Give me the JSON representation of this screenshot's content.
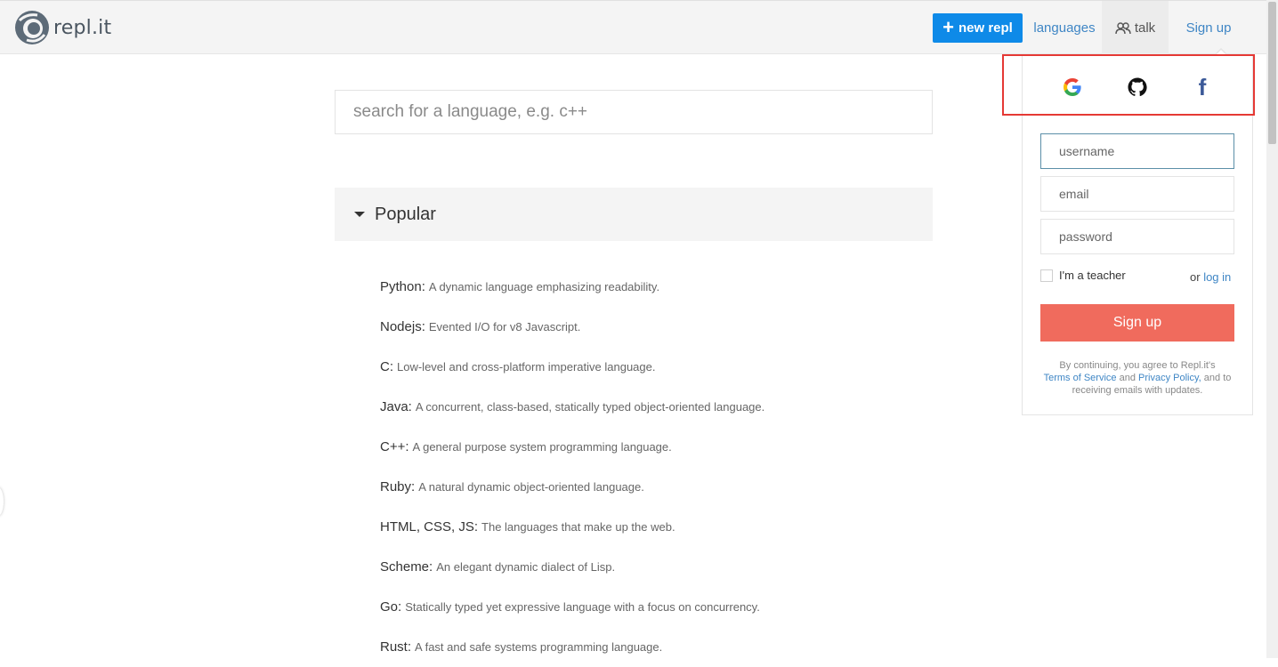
{
  "header": {
    "logo_text": "repl.it",
    "new_repl_label": "new repl",
    "nav": {
      "languages": "languages",
      "talk": "talk",
      "signup": "Sign up"
    }
  },
  "search": {
    "placeholder": "search for a language, e.g. c++"
  },
  "section": {
    "title": "Popular"
  },
  "languages": [
    {
      "name": "Python:",
      "desc": "A dynamic language emphasizing readability."
    },
    {
      "name": "Nodejs:",
      "desc": "Evented I/O for v8 Javascript."
    },
    {
      "name": "C:",
      "desc": "Low-level and cross-platform imperative language."
    },
    {
      "name": "Java:",
      "desc": "A concurrent, class-based, statically typed object-oriented language."
    },
    {
      "name": "C++:",
      "desc": "A general purpose system programming language."
    },
    {
      "name": "Ruby:",
      "desc": "A natural dynamic object-oriented language."
    },
    {
      "name": "HTML, CSS, JS:",
      "desc": "The languages that make up the web."
    },
    {
      "name": "Scheme:",
      "desc": "An elegant dynamic dialect of Lisp."
    },
    {
      "name": "Go:",
      "desc": "Statically typed yet expressive language with a focus on concurrency."
    },
    {
      "name": "Rust:",
      "desc": "A fast and safe systems programming language."
    }
  ],
  "signup_panel": {
    "social": {
      "google_label": "G",
      "facebook_label": "f"
    },
    "username_placeholder": "username",
    "email_placeholder": "email",
    "password_placeholder": "password",
    "teacher_label": "I'm a teacher",
    "or_text": "or",
    "login_link": "log in",
    "signup_button": "Sign up",
    "terms": {
      "prefix": "By continuing, you agree to Repl.it's",
      "tos": "Terms of Service",
      "and": "and",
      "privacy": "Privacy Policy,",
      "suffix": "and to receiving emails with updates."
    }
  },
  "colors": {
    "accent_blue": "#0e8ae8",
    "link_blue": "#3f86c5",
    "signup_red": "#f06b5d",
    "highlight_red": "#e53935"
  }
}
